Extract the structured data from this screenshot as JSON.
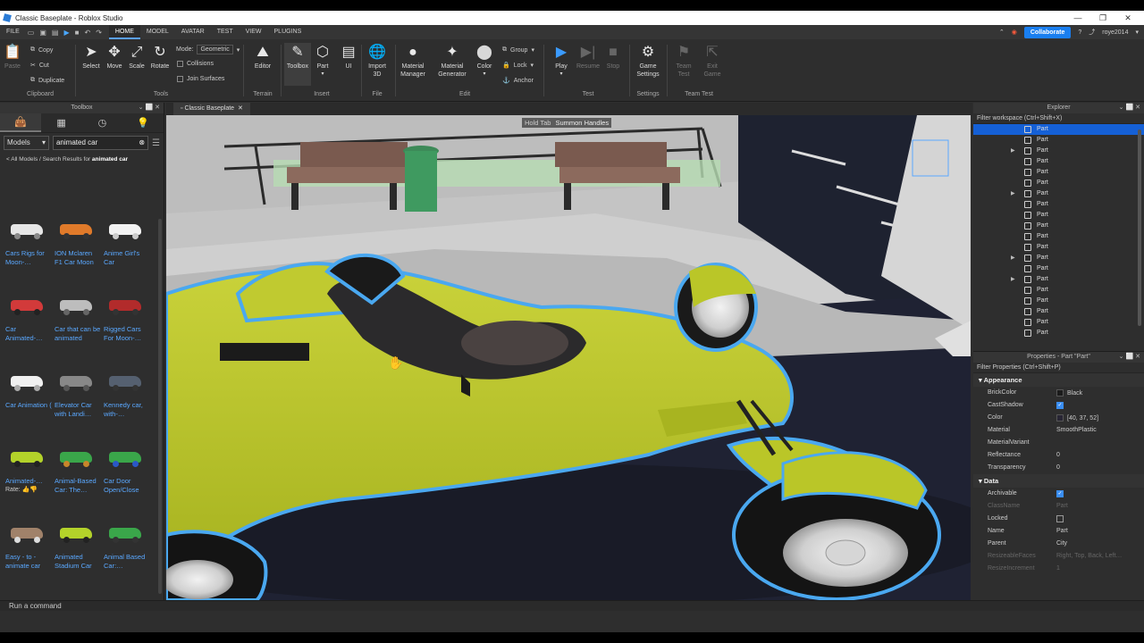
{
  "window": {
    "title": "Classic Baseplate - Roblox Studio"
  },
  "menubar": {
    "items": [
      "FILE",
      "HOME",
      "MODEL",
      "AVATAR",
      "TEST",
      "VIEW",
      "PLUGINS"
    ],
    "active": "HOME",
    "collaborate_label": "Collaborate",
    "username": "roye2014"
  },
  "ribbon": {
    "clipboard": {
      "paste": "Paste",
      "copy": "Copy",
      "cut": "Cut",
      "duplicate": "Duplicate",
      "group": "Clipboard"
    },
    "tools": {
      "select": "Select",
      "move": "Move",
      "scale": "Scale",
      "rotate": "Rotate",
      "mode_label": "Mode:",
      "mode_value": "Geometric",
      "collisions": "Collisions",
      "join_surfaces": "Join Surfaces",
      "group": "Tools"
    },
    "terrain": {
      "editor": "Editor",
      "group": "Terrain"
    },
    "insert": {
      "toolbox": "Toolbox",
      "part": "Part",
      "ui": "UI",
      "group": "Insert"
    },
    "file": {
      "import3d_1": "Import",
      "import3d_2": "3D",
      "group": "File"
    },
    "edit": {
      "material_manager_1": "Material",
      "material_manager_2": "Manager",
      "material_generator_1": "Material",
      "material_generator_2": "Generator",
      "color": "Color",
      "group_btn": "Group",
      "lock": "Lock",
      "anchor": "Anchor",
      "group": "Edit"
    },
    "test": {
      "play": "Play",
      "resume": "Resume",
      "stop": "Stop",
      "group": "Test"
    },
    "settings": {
      "game_settings_1": "Game",
      "game_settings_2": "Settings",
      "group": "Settings"
    },
    "teamtest": {
      "team_test_1": "Team",
      "team_test_2": "Test",
      "exit_game_1": "Exit",
      "exit_game_2": "Game",
      "group": "Team Test"
    }
  },
  "toolbox": {
    "title": "Toolbox",
    "category": "Models",
    "search_value": "animated car",
    "breadcrumb_prefix": "< All Models / Search Results for ",
    "breadcrumb_query": "animated car",
    "rate_label": "Rate:",
    "items": [
      {
        "name": "Cars Rigs for Moon-…",
        "thumb": "cars-rigs"
      },
      {
        "name": "ION Mclaren F1 Car Moon",
        "thumb": "mclaren"
      },
      {
        "name": "Anime Girl's Car",
        "thumb": "anime-car"
      },
      {
        "name": "Car Animated-…",
        "thumb": "red-car"
      },
      {
        "name": "Car that can be animated",
        "thumb": "grey-car"
      },
      {
        "name": "Rigged Cars For Moon-…",
        "thumb": "rigged-car"
      },
      {
        "name": "Car Animation (",
        "thumb": "white-car"
      },
      {
        "name": "Elevator Car with Landi…",
        "thumb": "elevator"
      },
      {
        "name": "Kennedy car, with-…",
        "thumb": "kennedy"
      },
      {
        "name": "Animated-…",
        "thumb": "green-racer"
      },
      {
        "name": "Animal-Based Car: The…",
        "thumb": "animal-car"
      },
      {
        "name": "Car Door Open/Close",
        "thumb": "door-box"
      },
      {
        "name": "Easy - to - animate car",
        "thumb": "easy-car"
      },
      {
        "name": "Animated Stadium Car",
        "thumb": "stadium-car"
      },
      {
        "name": "Animal Based Car:…",
        "thumb": "animal-based"
      }
    ]
  },
  "viewport": {
    "tab_label": "Classic Baseplate",
    "hint_key": "Hold Tab",
    "hint_text": "Summon Handles"
  },
  "explorer": {
    "title": "Explorer",
    "filter_placeholder": "Filter workspace (Ctrl+Shift+X)",
    "rows": [
      {
        "name": "Part",
        "expandable": false,
        "selected": true
      },
      {
        "name": "Part",
        "expandable": false
      },
      {
        "name": "Part",
        "expandable": true
      },
      {
        "name": "Part",
        "expandable": false
      },
      {
        "name": "Part",
        "expandable": false
      },
      {
        "name": "Part",
        "expandable": false
      },
      {
        "name": "Part",
        "expandable": true
      },
      {
        "name": "Part",
        "expandable": false
      },
      {
        "name": "Part",
        "expandable": false
      },
      {
        "name": "Part",
        "expandable": false
      },
      {
        "name": "Part",
        "expandable": false
      },
      {
        "name": "Part",
        "expandable": false
      },
      {
        "name": "Part",
        "expandable": true
      },
      {
        "name": "Part",
        "expandable": false
      },
      {
        "name": "Part",
        "expandable": true
      },
      {
        "name": "Part",
        "expandable": false
      },
      {
        "name": "Part",
        "expandable": false
      },
      {
        "name": "Part",
        "expandable": false
      },
      {
        "name": "Part",
        "expandable": false
      },
      {
        "name": "Part",
        "expandable": false
      }
    ]
  },
  "properties": {
    "title": "Properties - Part \"Part\"",
    "filter_placeholder": "Filter Properties (Ctrl+Shift+P)",
    "appearance_label": "Appearance",
    "data_label": "Data",
    "appearance": [
      {
        "key": "BrickColor",
        "value": "Black",
        "type": "swatch",
        "swatch": "#1b1b1b"
      },
      {
        "key": "CastShadow",
        "value": "",
        "type": "check",
        "checked": true
      },
      {
        "key": "Color",
        "value": "[40, 37, 52]",
        "type": "swatch",
        "swatch": "#282534"
      },
      {
        "key": "Material",
        "value": "SmoothPlastic",
        "type": "text"
      },
      {
        "key": "MaterialVariant",
        "value": "",
        "type": "text"
      },
      {
        "key": "Reflectance",
        "value": "0",
        "type": "text"
      },
      {
        "key": "Transparency",
        "value": "0",
        "type": "text"
      }
    ],
    "data": [
      {
        "key": "Archivable",
        "value": "",
        "type": "check",
        "checked": true
      },
      {
        "key": "ClassName",
        "value": "Part",
        "type": "text",
        "dim": true
      },
      {
        "key": "Locked",
        "value": "",
        "type": "check",
        "checked": false
      },
      {
        "key": "Name",
        "value": "Part",
        "type": "text"
      },
      {
        "key": "Parent",
        "value": "City",
        "type": "text"
      },
      {
        "key": "ResizeableFaces",
        "value": "Right, Top, Back, Left…",
        "type": "text",
        "dim": true
      },
      {
        "key": "ResizeIncrement",
        "value": "1",
        "type": "text",
        "dim": true
      }
    ]
  },
  "commandbar": {
    "placeholder": "Run a command"
  },
  "colors": {
    "accent": "#1a7ff0",
    "selection": "#1560d6",
    "car_body": "#b9c42a",
    "outline": "#4aa8f0"
  }
}
